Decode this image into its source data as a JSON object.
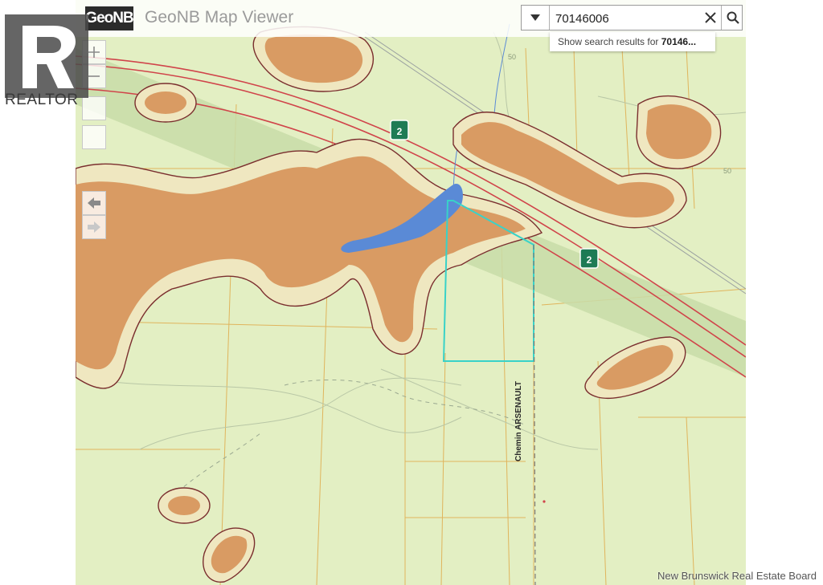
{
  "app": {
    "logo_text": "GeoNB",
    "title": "GeoNB Map Viewer"
  },
  "search": {
    "value": "70146006",
    "suggestion_prefix": "Show search results for ",
    "suggestion_query": "70146..."
  },
  "icons": {
    "dropdown": "caret-down-icon",
    "clear": "close-icon",
    "search": "search-icon",
    "zoom_in": "plus-icon",
    "zoom_out": "minus-icon",
    "back": "arrow-left-icon",
    "forward": "arrow-right-icon",
    "highway_shield": "highway-shield-icon"
  },
  "map": {
    "road_label": "Chemin ARSENAULT",
    "contour_label_1": "50",
    "contour_label_2": "50",
    "highway_number": "2",
    "colors": {
      "land": "#e3efc3",
      "wetland": "#d99b63",
      "water": "#5a8ad6",
      "highway_band": "#c8dca8",
      "highway_line": "#d0444a",
      "parcel_line": "#e0b45c",
      "selected_parcel": "#39d2c8",
      "wetland_buffer": "#7a2e2e"
    }
  },
  "watermark": {
    "realtor_text": "REALTOR",
    "board_text": "New Brunswick Real Estate Board"
  }
}
